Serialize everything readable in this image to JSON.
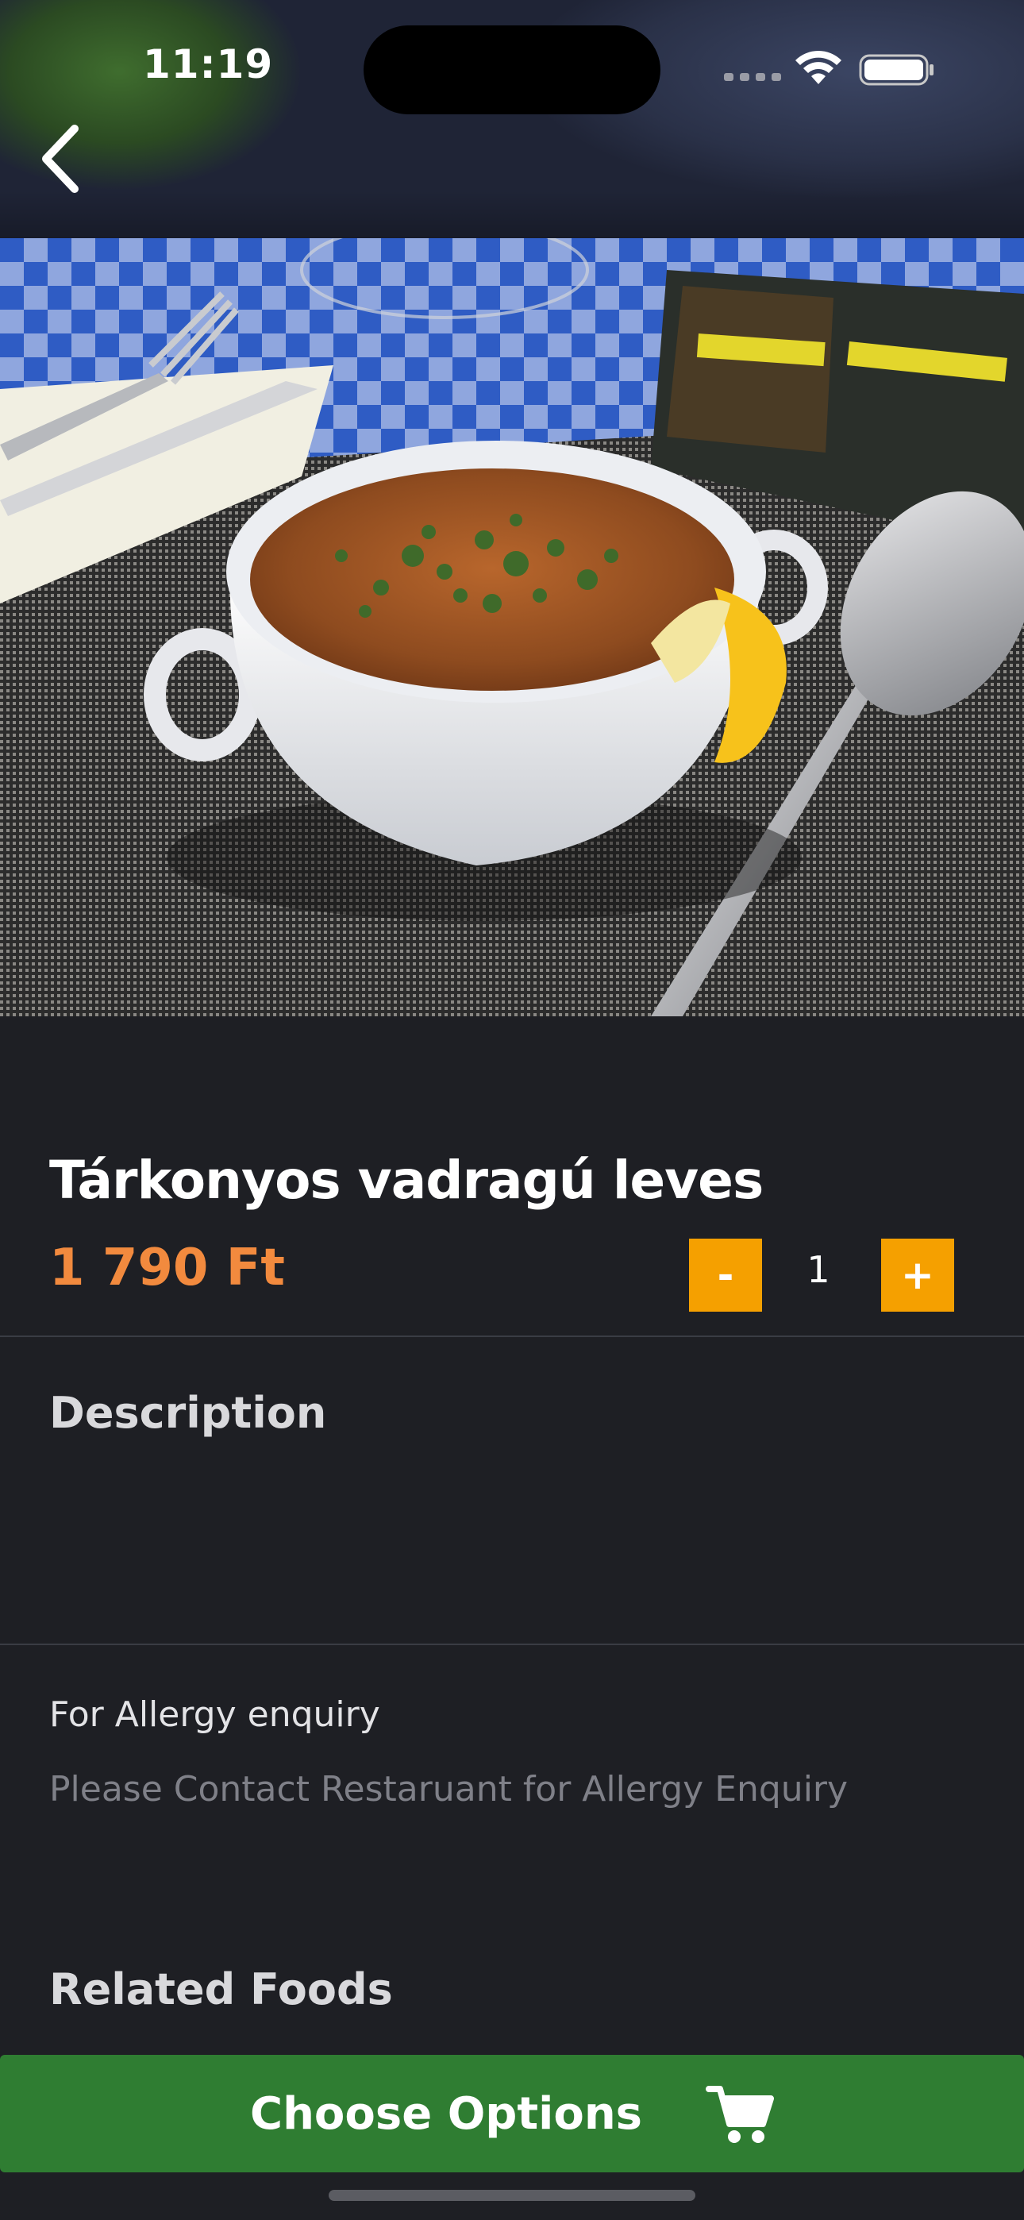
{
  "status_bar": {
    "time": "11:19"
  },
  "navigation": {
    "back_icon": "chevron-left-icon"
  },
  "product": {
    "image_alt": "",
    "title": "Tárkonyos vadragú leves",
    "price": "1 790 Ft",
    "quantity": "1",
    "decrement_label": "-",
    "increment_label": "+"
  },
  "description": {
    "heading": "Description",
    "body": ""
  },
  "allergy": {
    "label": "For Allergy enquiry",
    "text": "Please Contact Restaruant for Allergy Enquiry"
  },
  "related": {
    "heading": "Related Foods"
  },
  "footer": {
    "button_label": "Choose Options",
    "button_icon": "cart-icon"
  },
  "colors": {
    "background": "#1e1f24",
    "price": "#f28a3e",
    "quantity_button": "#f5a000",
    "primary_button": "#2f7d32"
  }
}
